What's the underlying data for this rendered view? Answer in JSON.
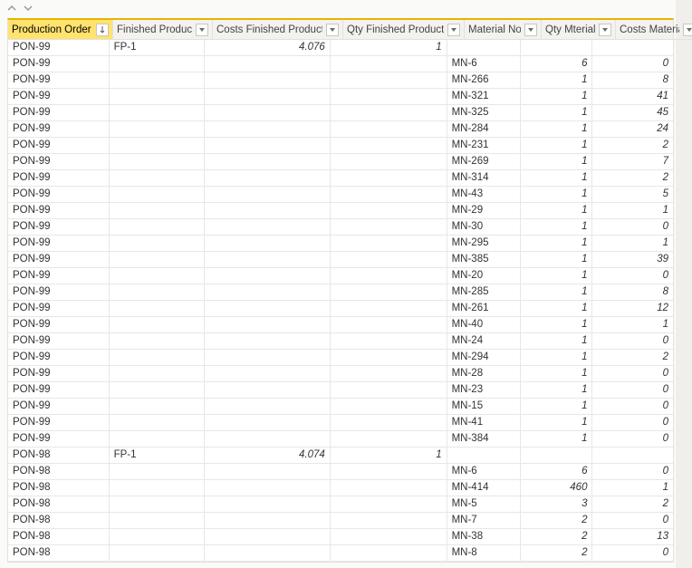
{
  "columns": [
    {
      "key": "pon",
      "label": "Production Order No",
      "align": "left",
      "width": "c0",
      "sorted": true,
      "sort_dir": "desc"
    },
    {
      "key": "fp",
      "label": "Finished Product",
      "align": "left",
      "width": "c1",
      "sorted": false
    },
    {
      "key": "costs_fp",
      "label": "Costs Finished Product",
      "align": "right",
      "width": "c2",
      "sorted": false
    },
    {
      "key": "qty_fp",
      "label": "Qty Finished Product",
      "align": "right",
      "width": "c3",
      "sorted": false
    },
    {
      "key": "mat",
      "label": "Material No",
      "align": "left",
      "width": "c4",
      "sorted": false
    },
    {
      "key": "qty_mat",
      "label": "Qty Mterial",
      "align": "right",
      "width": "c5",
      "sorted": false
    },
    {
      "key": "costs_mat",
      "label": "Costs Material",
      "align": "right",
      "width": "c6",
      "sorted": false
    }
  ],
  "rows": [
    {
      "pon": "PON-99",
      "fp": "FP-1",
      "costs_fp": "4.076",
      "qty_fp": "1",
      "mat": "",
      "qty_mat": "",
      "costs_mat": ""
    },
    {
      "pon": "PON-99",
      "fp": "",
      "costs_fp": "",
      "qty_fp": "",
      "mat": "MN-6",
      "qty_mat": "6",
      "costs_mat": "0"
    },
    {
      "pon": "PON-99",
      "fp": "",
      "costs_fp": "",
      "qty_fp": "",
      "mat": "MN-266",
      "qty_mat": "1",
      "costs_mat": "8"
    },
    {
      "pon": "PON-99",
      "fp": "",
      "costs_fp": "",
      "qty_fp": "",
      "mat": "MN-321",
      "qty_mat": "1",
      "costs_mat": "41"
    },
    {
      "pon": "PON-99",
      "fp": "",
      "costs_fp": "",
      "qty_fp": "",
      "mat": "MN-325",
      "qty_mat": "1",
      "costs_mat": "45"
    },
    {
      "pon": "PON-99",
      "fp": "",
      "costs_fp": "",
      "qty_fp": "",
      "mat": "MN-284",
      "qty_mat": "1",
      "costs_mat": "24"
    },
    {
      "pon": "PON-99",
      "fp": "",
      "costs_fp": "",
      "qty_fp": "",
      "mat": "MN-231",
      "qty_mat": "1",
      "costs_mat": "2"
    },
    {
      "pon": "PON-99",
      "fp": "",
      "costs_fp": "",
      "qty_fp": "",
      "mat": "MN-269",
      "qty_mat": "1",
      "costs_mat": "7"
    },
    {
      "pon": "PON-99",
      "fp": "",
      "costs_fp": "",
      "qty_fp": "",
      "mat": "MN-314",
      "qty_mat": "1",
      "costs_mat": "2"
    },
    {
      "pon": "PON-99",
      "fp": "",
      "costs_fp": "",
      "qty_fp": "",
      "mat": "MN-43",
      "qty_mat": "1",
      "costs_mat": "5"
    },
    {
      "pon": "PON-99",
      "fp": "",
      "costs_fp": "",
      "qty_fp": "",
      "mat": "MN-29",
      "qty_mat": "1",
      "costs_mat": "1"
    },
    {
      "pon": "PON-99",
      "fp": "",
      "costs_fp": "",
      "qty_fp": "",
      "mat": "MN-30",
      "qty_mat": "1",
      "costs_mat": "0"
    },
    {
      "pon": "PON-99",
      "fp": "",
      "costs_fp": "",
      "qty_fp": "",
      "mat": "MN-295",
      "qty_mat": "1",
      "costs_mat": "1"
    },
    {
      "pon": "PON-99",
      "fp": "",
      "costs_fp": "",
      "qty_fp": "",
      "mat": "MN-385",
      "qty_mat": "1",
      "costs_mat": "39"
    },
    {
      "pon": "PON-99",
      "fp": "",
      "costs_fp": "",
      "qty_fp": "",
      "mat": "MN-20",
      "qty_mat": "1",
      "costs_mat": "0"
    },
    {
      "pon": "PON-99",
      "fp": "",
      "costs_fp": "",
      "qty_fp": "",
      "mat": "MN-285",
      "qty_mat": "1",
      "costs_mat": "8"
    },
    {
      "pon": "PON-99",
      "fp": "",
      "costs_fp": "",
      "qty_fp": "",
      "mat": "MN-261",
      "qty_mat": "1",
      "costs_mat": "12"
    },
    {
      "pon": "PON-99",
      "fp": "",
      "costs_fp": "",
      "qty_fp": "",
      "mat": "MN-40",
      "qty_mat": "1",
      "costs_mat": "1"
    },
    {
      "pon": "PON-99",
      "fp": "",
      "costs_fp": "",
      "qty_fp": "",
      "mat": "MN-24",
      "qty_mat": "1",
      "costs_mat": "0"
    },
    {
      "pon": "PON-99",
      "fp": "",
      "costs_fp": "",
      "qty_fp": "",
      "mat": "MN-294",
      "qty_mat": "1",
      "costs_mat": "2"
    },
    {
      "pon": "PON-99",
      "fp": "",
      "costs_fp": "",
      "qty_fp": "",
      "mat": "MN-28",
      "qty_mat": "1",
      "costs_mat": "0"
    },
    {
      "pon": "PON-99",
      "fp": "",
      "costs_fp": "",
      "qty_fp": "",
      "mat": "MN-23",
      "qty_mat": "1",
      "costs_mat": "0"
    },
    {
      "pon": "PON-99",
      "fp": "",
      "costs_fp": "",
      "qty_fp": "",
      "mat": "MN-15",
      "qty_mat": "1",
      "costs_mat": "0"
    },
    {
      "pon": "PON-99",
      "fp": "",
      "costs_fp": "",
      "qty_fp": "",
      "mat": "MN-41",
      "qty_mat": "1",
      "costs_mat": "0"
    },
    {
      "pon": "PON-99",
      "fp": "",
      "costs_fp": "",
      "qty_fp": "",
      "mat": "MN-384",
      "qty_mat": "1",
      "costs_mat": "0"
    },
    {
      "pon": "PON-98",
      "fp": "FP-1",
      "costs_fp": "4.074",
      "qty_fp": "1",
      "mat": "",
      "qty_mat": "",
      "costs_mat": ""
    },
    {
      "pon": "PON-98",
      "fp": "",
      "costs_fp": "",
      "qty_fp": "",
      "mat": "MN-6",
      "qty_mat": "6",
      "costs_mat": "0"
    },
    {
      "pon": "PON-98",
      "fp": "",
      "costs_fp": "",
      "qty_fp": "",
      "mat": "MN-414",
      "qty_mat": "460",
      "costs_mat": "1"
    },
    {
      "pon": "PON-98",
      "fp": "",
      "costs_fp": "",
      "qty_fp": "",
      "mat": "MN-5",
      "qty_mat": "3",
      "costs_mat": "2"
    },
    {
      "pon": "PON-98",
      "fp": "",
      "costs_fp": "",
      "qty_fp": "",
      "mat": "MN-7",
      "qty_mat": "2",
      "costs_mat": "0"
    },
    {
      "pon": "PON-98",
      "fp": "",
      "costs_fp": "",
      "qty_fp": "",
      "mat": "MN-38",
      "qty_mat": "2",
      "costs_mat": "13"
    },
    {
      "pon": "PON-98",
      "fp": "",
      "costs_fp": "",
      "qty_fp": "",
      "mat": "MN-8",
      "qty_mat": "2",
      "costs_mat": "0"
    }
  ]
}
